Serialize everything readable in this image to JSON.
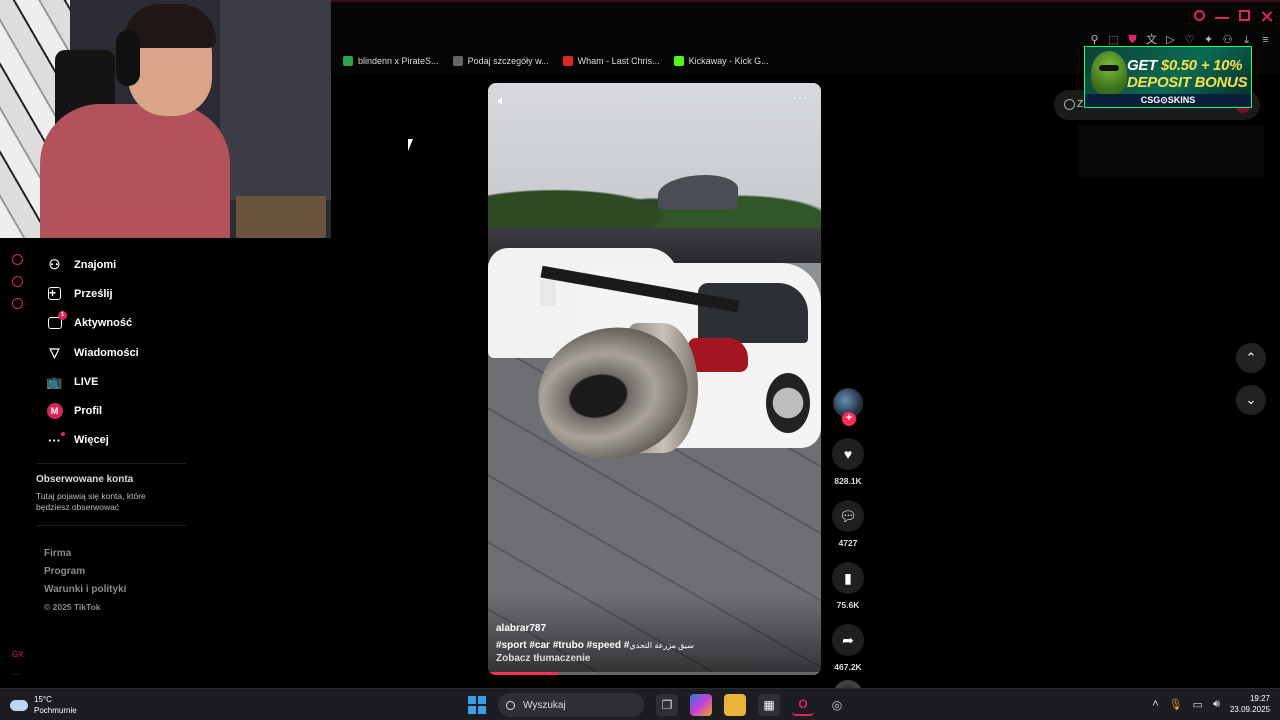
{
  "browser": {
    "bookmarks": [
      {
        "label": "blindenn x PirateS...",
        "color": "#2ea44f"
      },
      {
        "label": "Podaj szczegóły w...",
        "color": "#666666"
      },
      {
        "label": "Wham - Last Chris...",
        "color": "#e02424"
      },
      {
        "label": "Kickaway - Kick G...",
        "color": "#53fc18"
      }
    ],
    "toolbar_icons": [
      "pin-icon",
      "snapshot-icon",
      "shield-icon",
      "translate-icon",
      "play-icon",
      "heart-icon",
      "extensions-icon",
      "account-icon",
      "download-icon",
      "menu-icon"
    ],
    "window_controls": [
      "search-icon",
      "minimize-icon",
      "maximize-icon",
      "close-icon"
    ],
    "accent": "#e0245e"
  },
  "ad": {
    "line1_a": "GET ",
    "line1_b": "$0.50 + 10%",
    "line2": "DEPOSIT BONUS",
    "footer": "CSG⊙SKINS"
  },
  "search_pill": {
    "text": "Z"
  },
  "sidebar": {
    "items": [
      {
        "label": "Znajomi",
        "icon": "friends-icon"
      },
      {
        "label": "Prześlij",
        "icon": "upload-icon"
      },
      {
        "label": "Aktywność",
        "icon": "activity-icon",
        "badge": "1"
      },
      {
        "label": "Wiadomości",
        "icon": "messages-icon"
      },
      {
        "label": "LIVE",
        "icon": "live-icon"
      },
      {
        "label": "Profil",
        "icon": "profile-avatar",
        "avatar_letter": "M"
      },
      {
        "label": "Więcej",
        "icon": "more-icon"
      }
    ],
    "followed_title": "Obserwowane konta",
    "followed_desc": "Tutaj pojawią się konta, które będziesz obserwować",
    "footer_links": [
      "Firma",
      "Program",
      "Warunki i polityki"
    ],
    "copyright": "© 2025 TikTok",
    "rail_text": "GX"
  },
  "video": {
    "username": "alabrar787",
    "tags": "#sport  #car  #trubo  #speed  #",
    "tags_arabic": "سيق  مزرعة التحدي",
    "translate": "Zobacz tłumaczenie",
    "progress": 0.21
  },
  "actions": {
    "likes": "828.1K",
    "comments": "4727",
    "saves": "75.6K",
    "shares": "467.2K"
  },
  "taskbar": {
    "temp": "15°C",
    "weather": "Pochmurnie",
    "search_placeholder": "Wyszukaj",
    "time": "19:27",
    "date": "23.09.2025"
  }
}
